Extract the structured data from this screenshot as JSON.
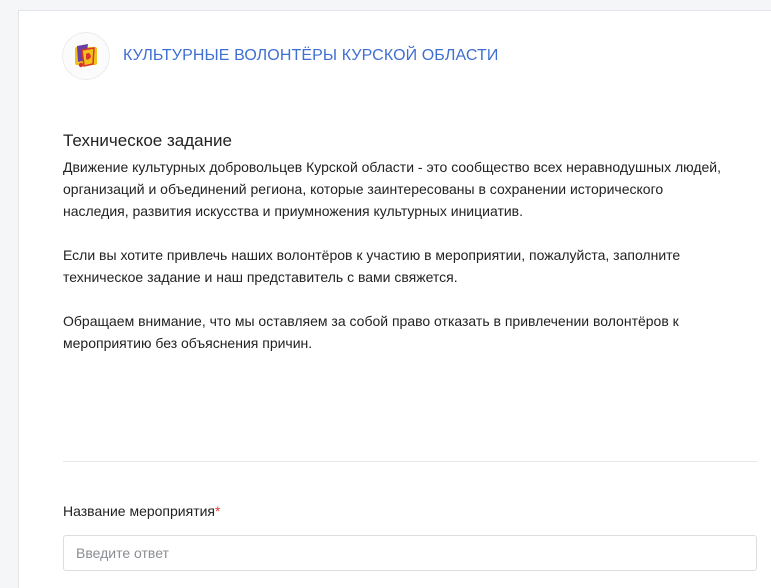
{
  "header": {
    "org_name": "КУЛЬТУРНЫЕ ВОЛОНТЁРЫ КУРСКОЙ ОБЛАСТИ",
    "logo_icon": "volunteers-logo-icon"
  },
  "form": {
    "title": "Техническое задание",
    "paragraphs": [
      "Движение культурных добровольцев Курской области - это сообщество всех неравнодушных людей, организаций и объединений региона, которые заинтересованы в сохранении исторического наследия, развития искусства и приумножения культурных инициатив.",
      "Если вы хотите привлечь наших волонтёров к участию в мероприятии, пожалуйста, заполните техническое задание и наш представитель с вами свяжется.",
      "Обращаем внимание, что мы оставляем за собой право отказать в привлечении волонтёров к мероприятию без объяснения причин."
    ]
  },
  "questions": [
    {
      "label": "Название мероприятия",
      "required_mark": "*",
      "value": "",
      "placeholder": "Введите ответ"
    }
  ],
  "colors": {
    "accent": "#3f6fd1",
    "required": "#e53935",
    "logo_yellow": "#f2c21b",
    "logo_purple": "#6b3fa0",
    "logo_red": "#d8342c"
  }
}
